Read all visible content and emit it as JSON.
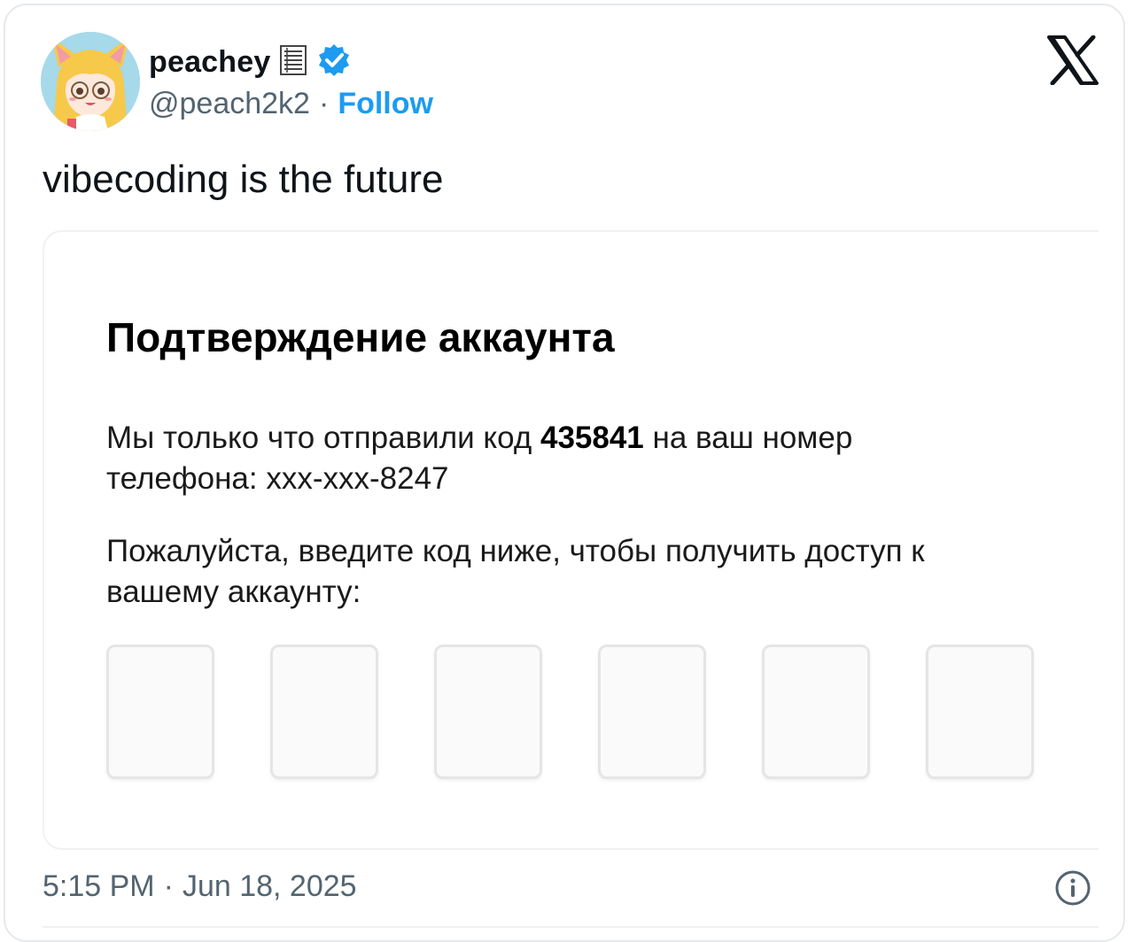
{
  "author": {
    "display_name": "peachey",
    "handle": "@peach2k2",
    "separator": "·",
    "follow_label": "Follow",
    "avatar_icon": "anime-girl-avatar",
    "verified_color": "#1d9bf0"
  },
  "tweet": {
    "text": "vibecoding is the future"
  },
  "media": {
    "title": "Подтверждение аккаунта",
    "para1_before": "Мы только что отправили код ",
    "code": "435841",
    "para1_after": " на ваш номер телефона: xxx-xxx-8247",
    "para2": "Пожалуйста, введите код ниже, чтобы получить доступ к вашему аккаунту:",
    "code_boxes": [
      "",
      "",
      "",
      "",
      "",
      ""
    ]
  },
  "footer": {
    "time": "5:15 PM",
    "separator": "·",
    "date": "Jun 18, 2025"
  },
  "icons": {
    "logo": "x-logo-icon",
    "info": "info-icon",
    "badge": "book-icon"
  }
}
